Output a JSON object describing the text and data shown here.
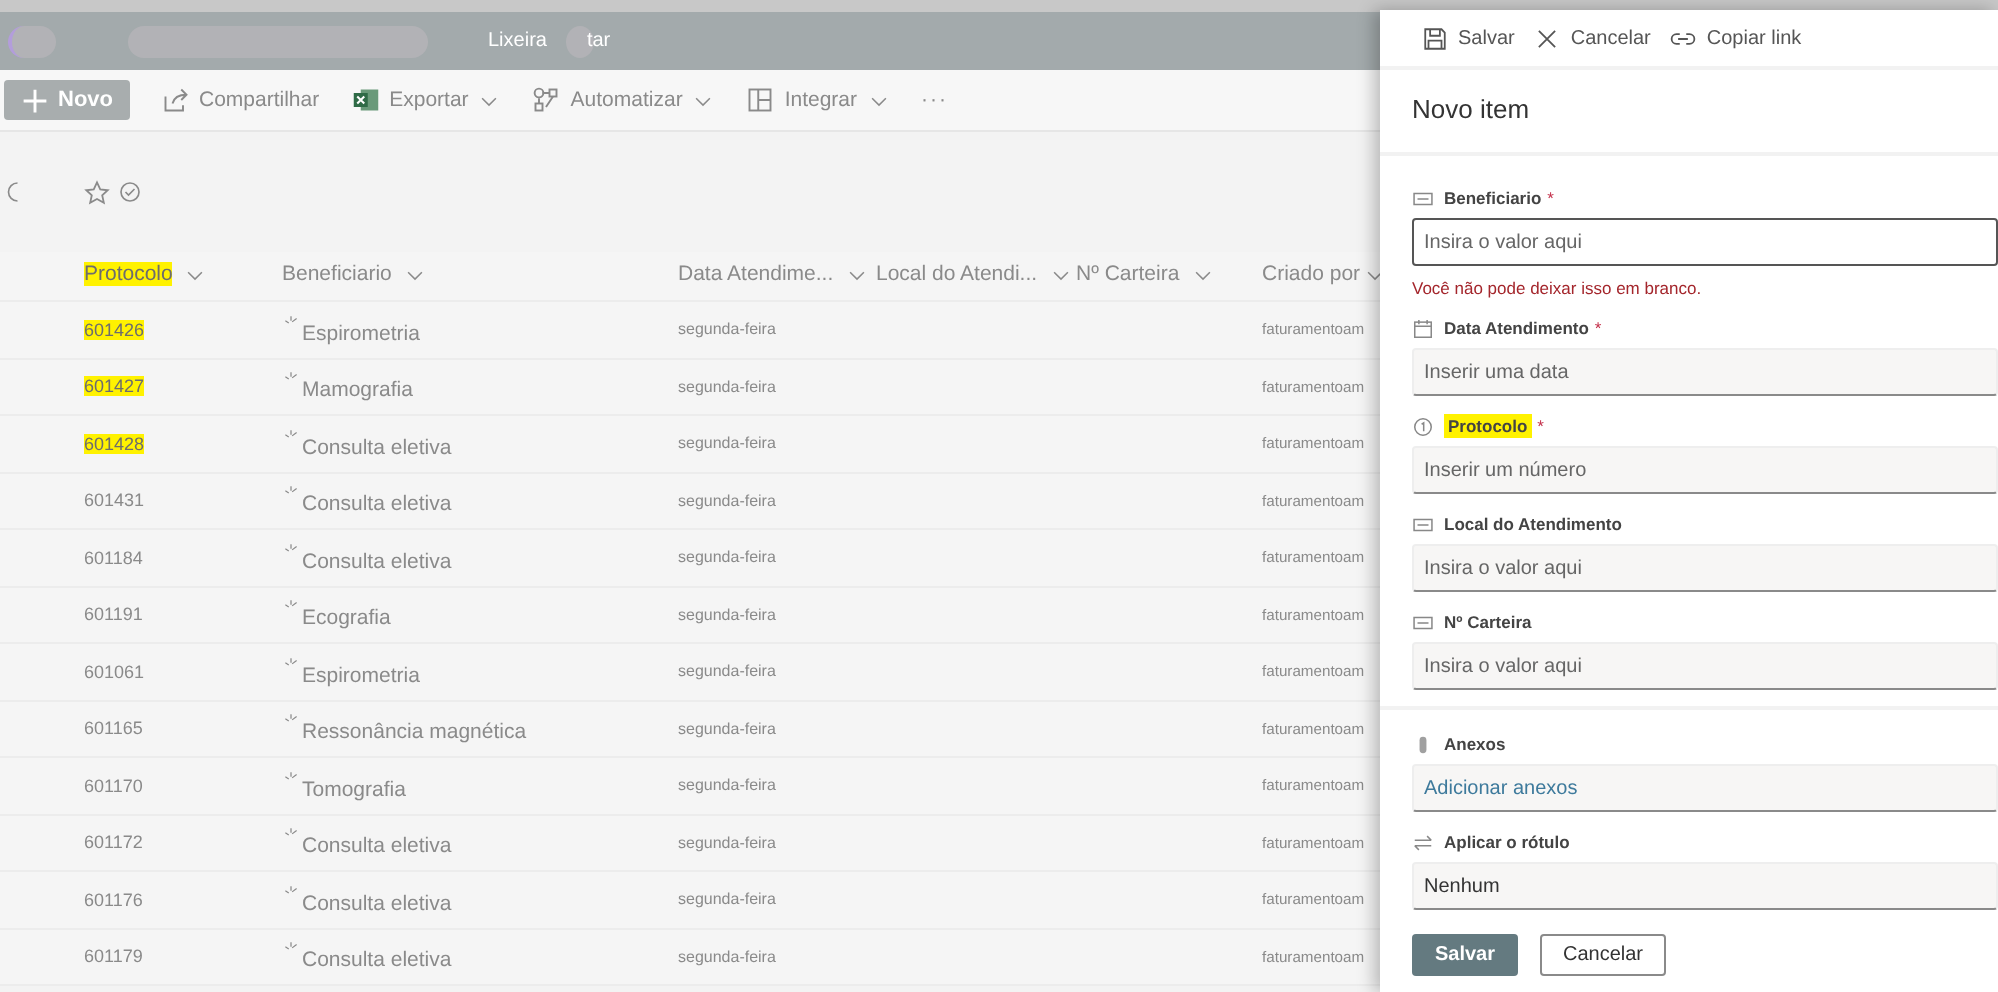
{
  "header": {
    "tabs": [
      {
        "label": "Lixeira"
      },
      {
        "label": "tar"
      }
    ]
  },
  "command_bar": {
    "new_button": "Novo",
    "items": [
      {
        "label": "Compartilhar",
        "kind": "share",
        "dropdown": false
      },
      {
        "label": "Exportar",
        "kind": "excel",
        "dropdown": true
      },
      {
        "label": "Automatizar",
        "kind": "flow",
        "dropdown": true
      },
      {
        "label": "Integrar",
        "kind": "grid",
        "dropdown": true
      }
    ],
    "more": "···"
  },
  "list": {
    "columns": [
      {
        "label": "Protocolo",
        "highlighted": true
      },
      {
        "label": "Beneficiario",
        "highlighted": false
      },
      {
        "label": "Data Atendime...",
        "highlighted": false
      },
      {
        "label": "Local do Atendi...",
        "highlighted": false
      },
      {
        "label": "Nº Carteira",
        "highlighted": false
      },
      {
        "label": "Criado por",
        "highlighted": false
      }
    ],
    "rows": [
      {
        "protocolo": "601426",
        "highlighted": true,
        "beneficiario": "Espirometria",
        "data": "segunda-feira",
        "criado_por": "faturamentoam"
      },
      {
        "protocolo": "601427",
        "highlighted": true,
        "beneficiario": "Mamografia",
        "data": "segunda-feira",
        "criado_por": "faturamentoam"
      },
      {
        "protocolo": "601428",
        "highlighted": true,
        "beneficiario": "Consulta eletiva",
        "data": "segunda-feira",
        "criado_por": "faturamentoam"
      },
      {
        "protocolo": "601431",
        "highlighted": false,
        "beneficiario": "Consulta eletiva",
        "data": "segunda-feira",
        "criado_por": "faturamentoam"
      },
      {
        "protocolo": "601184",
        "highlighted": false,
        "beneficiario": "Consulta eletiva",
        "data": "segunda-feira",
        "criado_por": "faturamentoam"
      },
      {
        "protocolo": "601191",
        "highlighted": false,
        "beneficiario": "Ecografia",
        "data": "segunda-feira",
        "criado_por": "faturamentoam"
      },
      {
        "protocolo": "601061",
        "highlighted": false,
        "beneficiario": "Espirometria",
        "data": "segunda-feira",
        "criado_por": "faturamentoam"
      },
      {
        "protocolo": "601165",
        "highlighted": false,
        "beneficiario": "Ressonância magnética",
        "data": "segunda-feira",
        "criado_por": "faturamentoam"
      },
      {
        "protocolo": "601170",
        "highlighted": false,
        "beneficiario": "Tomografia",
        "data": "segunda-feira",
        "criado_por": "faturamentoam"
      },
      {
        "protocolo": "601172",
        "highlighted": false,
        "beneficiario": "Consulta eletiva",
        "data": "segunda-feira",
        "criado_por": "faturamentoam"
      },
      {
        "protocolo": "601176",
        "highlighted": false,
        "beneficiario": "Consulta eletiva",
        "data": "segunda-feira",
        "criado_por": "faturamentoam"
      },
      {
        "protocolo": "601179",
        "highlighted": false,
        "beneficiario": "Consulta eletiva",
        "data": "segunda-feira",
        "criado_por": "faturamentoam"
      }
    ]
  },
  "panel": {
    "toolbar": [
      {
        "label": "Salvar",
        "kind": "save"
      },
      {
        "label": "Cancelar",
        "kind": "cancel"
      },
      {
        "label": "Copiar link",
        "kind": "link"
      }
    ],
    "title": "Novo item",
    "fields": [
      {
        "kind": "text",
        "label": "Beneficiario",
        "required_mark": "*",
        "highlighted": false,
        "placeholder": "Insira o valor aqui",
        "focused": true,
        "error": "Você não pode deixar isso em branco."
      },
      {
        "kind": "date",
        "label": "Data Atendimento",
        "required_mark": "*",
        "highlighted": false,
        "placeholder": "Inserir uma data",
        "focused": false
      },
      {
        "kind": "number",
        "label": "Protocolo",
        "required_mark": "*",
        "highlighted": true,
        "placeholder": "Inserir um número",
        "focused": false
      },
      {
        "kind": "text",
        "label": "Local do Atendimento",
        "highlighted": false,
        "placeholder": "Insira o valor aqui",
        "focused": false
      },
      {
        "kind": "text",
        "label": "Nº Carteira",
        "highlighted": false,
        "placeholder": "Insira o valor aqui",
        "focused": false
      },
      {
        "kind": "attachment",
        "label": "Anexos",
        "highlighted": false,
        "placeholder": "Adicionar anexos",
        "focused": false
      },
      {
        "kind": "label",
        "label": "Aplicar o rótulo",
        "highlighted": false,
        "value": "Nenhum",
        "focused": false
      }
    ],
    "buttons": [
      {
        "label": "Salvar",
        "kind": "primary"
      },
      {
        "label": "Cancelar",
        "kind": "secondary"
      }
    ]
  }
}
